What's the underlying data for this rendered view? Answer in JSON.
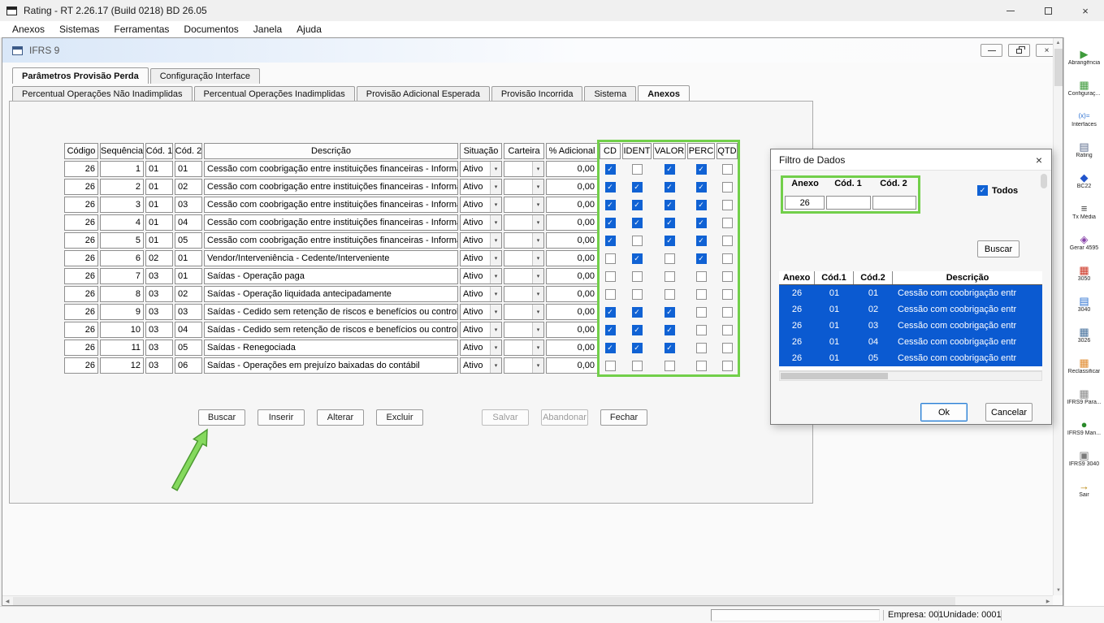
{
  "window": {
    "title": "Rating - RT 2.26.17 (Build 0218) BD 26.05"
  },
  "menu": {
    "items": [
      "Anexos",
      "Sistemas",
      "Ferramentas",
      "Documentos",
      "Janela",
      "Ajuda"
    ]
  },
  "icons": {
    "close": "×",
    "combo_arrow": "▾",
    "check": "✓",
    "scroll_up": "▲",
    "scroll_down": "▼",
    "scroll_left": "◀",
    "scroll_right": "▶"
  },
  "child_window": {
    "title": "IFRS 9",
    "tabs_row1": [
      {
        "label": "Parâmetros Provisão Perda",
        "active": true
      },
      {
        "label": "Configuração Interface",
        "active": false
      }
    ],
    "tabs_row2": [
      {
        "label": "Percentual Operações Não Inadimplidas",
        "active": false
      },
      {
        "label": "Percentual Operações Inadimplidas",
        "active": false
      },
      {
        "label": "Provisão Adicional Esperada",
        "active": false
      },
      {
        "label": "Provisão Incorrida",
        "active": false
      },
      {
        "label": "Sistema",
        "active": false
      },
      {
        "label": "Anexos",
        "active": true
      }
    ]
  },
  "main_table": {
    "headers": [
      "Código",
      "Sequência",
      "Cód. 1",
      "Cód. 2",
      "Descrição",
      "Situação",
      "Carteira",
      "% Adicional",
      "CD",
      "IDENT",
      "VALOR",
      "PERC",
      "QTD"
    ],
    "rows": [
      {
        "codigo": "26",
        "sequencia": "1",
        "cod1": "01",
        "cod2": "01",
        "descricao": "Cessão com coobrigação entre instituições financeiras - Informaç",
        "situacao": "Ativo",
        "carteira": "",
        "adicional": "0,00",
        "cd": true,
        "ident": false,
        "valor": true,
        "perc": true,
        "qtd": false
      },
      {
        "codigo": "26",
        "sequencia": "2",
        "cod1": "01",
        "cod2": "02",
        "descricao": "Cessão com coobrigação entre instituições financeiras - Informaç",
        "situacao": "Ativo",
        "carteira": "",
        "adicional": "0,00",
        "cd": true,
        "ident": true,
        "valor": true,
        "perc": true,
        "qtd": false
      },
      {
        "codigo": "26",
        "sequencia": "3",
        "cod1": "01",
        "cod2": "03",
        "descricao": "Cessão com coobrigação entre instituições financeiras - Informaç",
        "situacao": "Ativo",
        "carteira": "",
        "adicional": "0,00",
        "cd": true,
        "ident": true,
        "valor": true,
        "perc": true,
        "qtd": false
      },
      {
        "codigo": "26",
        "sequencia": "4",
        "cod1": "01",
        "cod2": "04",
        "descricao": "Cessão com coobrigação entre instituições financeiras - Informaç",
        "situacao": "Ativo",
        "carteira": "",
        "adicional": "0,00",
        "cd": true,
        "ident": true,
        "valor": true,
        "perc": true,
        "qtd": false
      },
      {
        "codigo": "26",
        "sequencia": "5",
        "cod1": "01",
        "cod2": "05",
        "descricao": "Cessão com coobrigação entre instituições financeiras -  Informaç",
        "situacao": "Ativo",
        "carteira": "",
        "adicional": "0,00",
        "cd": true,
        "ident": false,
        "valor": true,
        "perc": true,
        "qtd": false
      },
      {
        "codigo": "26",
        "sequencia": "6",
        "cod1": "02",
        "cod2": "01",
        "descricao": "Vendor/Interveniência - Cedente/Interveniente",
        "situacao": "Ativo",
        "carteira": "",
        "adicional": "0,00",
        "cd": false,
        "ident": true,
        "valor": false,
        "perc": true,
        "qtd": false
      },
      {
        "codigo": "26",
        "sequencia": "7",
        "cod1": "03",
        "cod2": "01",
        "descricao": "Saídas - Operação paga",
        "situacao": "Ativo",
        "carteira": "",
        "adicional": "0,00",
        "cd": false,
        "ident": false,
        "valor": false,
        "perc": false,
        "qtd": false
      },
      {
        "codigo": "26",
        "sequencia": "8",
        "cod1": "03",
        "cod2": "02",
        "descricao": "Saídas - Operação liquidada antecipadamente",
        "situacao": "Ativo",
        "carteira": "",
        "adicional": "0,00",
        "cd": false,
        "ident": false,
        "valor": false,
        "perc": false,
        "qtd": false
      },
      {
        "codigo": "26",
        "sequencia": "9",
        "cod1": "03",
        "cod2": "03",
        "descricao": "Saídas - Cedido sem retenção de riscos e benefícios ou controle",
        "situacao": "Ativo",
        "carteira": "",
        "adicional": "0,00",
        "cd": true,
        "ident": true,
        "valor": true,
        "perc": false,
        "qtd": false
      },
      {
        "codigo": "26",
        "sequencia": "10",
        "cod1": "03",
        "cod2": "04",
        "descricao": "Saídas - Cedido sem retenção de riscos e benefícios ou controle",
        "situacao": "Ativo",
        "carteira": "",
        "adicional": "0,00",
        "cd": true,
        "ident": true,
        "valor": true,
        "perc": false,
        "qtd": false
      },
      {
        "codigo": "26",
        "sequencia": "11",
        "cod1": "03",
        "cod2": "05",
        "descricao": "Saídas - Renegociada",
        "situacao": "Ativo",
        "carteira": "",
        "adicional": "0,00",
        "cd": true,
        "ident": true,
        "valor": true,
        "perc": false,
        "qtd": false
      },
      {
        "codigo": "26",
        "sequencia": "12",
        "cod1": "03",
        "cod2": "06",
        "descricao": "Saídas - Operações em prejuízo baixadas do contábil",
        "situacao": "Ativo",
        "carteira": "",
        "adicional": "0,00",
        "cd": false,
        "ident": false,
        "valor": false,
        "perc": false,
        "qtd": false
      }
    ]
  },
  "action_buttons": [
    {
      "label": "Buscar",
      "enabled": true
    },
    {
      "label": "Inserir",
      "enabled": true
    },
    {
      "label": "Alterar",
      "enabled": true
    },
    {
      "label": "Excluir",
      "enabled": true
    },
    {
      "label": "Salvar",
      "enabled": false
    },
    {
      "label": "Abandonar",
      "enabled": false
    },
    {
      "label": "Fechar",
      "enabled": true
    }
  ],
  "dialog": {
    "title": "Filtro de Dados",
    "filter_headers": [
      "Anexo",
      "Cód. 1",
      "Cód. 2"
    ],
    "filter_values": [
      "26",
      "",
      ""
    ],
    "todos_label": "Todos",
    "todos_checked": true,
    "buscar_label": "Buscar",
    "grid_headers": [
      "Anexo",
      "Cód.1",
      "Cód.2",
      "Descrição"
    ],
    "grid_rows": [
      {
        "anexo": "26",
        "cod1": "01",
        "cod2": "01",
        "descricao": "Cessão com coobrigação entr"
      },
      {
        "anexo": "26",
        "cod1": "01",
        "cod2": "02",
        "descricao": "Cessão com coobrigação entr"
      },
      {
        "anexo": "26",
        "cod1": "01",
        "cod2": "03",
        "descricao": "Cessão com coobrigação entr"
      },
      {
        "anexo": "26",
        "cod1": "01",
        "cod2": "04",
        "descricao": "Cessão com coobrigação entr"
      },
      {
        "anexo": "26",
        "cod1": "01",
        "cod2": "05",
        "descricao": "Cessão com coobrigação entr"
      }
    ],
    "ok_label": "Ok",
    "cancel_label": "Cancelar"
  },
  "sidebar": {
    "items": [
      {
        "label": "Abrangência",
        "icon": "scope-icon",
        "glyph": "▶",
        "color": "#3f9b3c"
      },
      {
        "label": "Configuraç...",
        "icon": "config-grid-icon",
        "glyph": "▦",
        "color": "#3f9b3c"
      },
      {
        "label": "Interfaces",
        "icon": "interfaces-icon",
        "glyph": "(x)=",
        "color": "#2a6fd1"
      },
      {
        "label": "Rating",
        "icon": "rating-printer-icon",
        "glyph": "▤",
        "color": "#5a6b8c"
      },
      {
        "label": "BC22",
        "icon": "bc22-icon",
        "glyph": "◆",
        "color": "#2255cc"
      },
      {
        "label": "Tx Média",
        "icon": "tx-media-icon",
        "glyph": "≡",
        "color": "#444444"
      },
      {
        "label": "Gerar 4595",
        "icon": "gerar-4595-icon",
        "glyph": "◈",
        "color": "#8844aa"
      },
      {
        "label": "3050",
        "icon": "doc-3050-icon",
        "glyph": "▦",
        "color": "#cc3322"
      },
      {
        "label": "3040",
        "icon": "doc-3040-icon",
        "glyph": "▤",
        "color": "#2a6fd1"
      },
      {
        "label": "3026",
        "icon": "doc-3026-icon",
        "glyph": "▦",
        "color": "#46719c"
      },
      {
        "label": "Reclassificar",
        "icon": "reclassificar-icon",
        "glyph": "▦",
        "color": "#e08a2e"
      },
      {
        "label": "IFRS9 Para...",
        "icon": "ifrs9-param-icon",
        "glyph": "▦",
        "color": "#8a8a8a"
      },
      {
        "label": "IFRS9 Man...",
        "icon": "ifrs9-man-icon",
        "glyph": "●",
        "color": "#2a8a2a"
      },
      {
        "label": "IFRS9 3040",
        "icon": "ifrs9-3040-icon",
        "glyph": "▣",
        "color": "#7a7a7a"
      },
      {
        "label": "Sair",
        "icon": "exit-icon",
        "glyph": "→",
        "color": "#b8860b"
      }
    ]
  },
  "status_bar": {
    "empresa": "Empresa: 001",
    "unidade": "Unidade: 0001"
  },
  "annotations": {
    "highlight_color": "#72cf4a",
    "arrow_color": "#85d95e"
  }
}
